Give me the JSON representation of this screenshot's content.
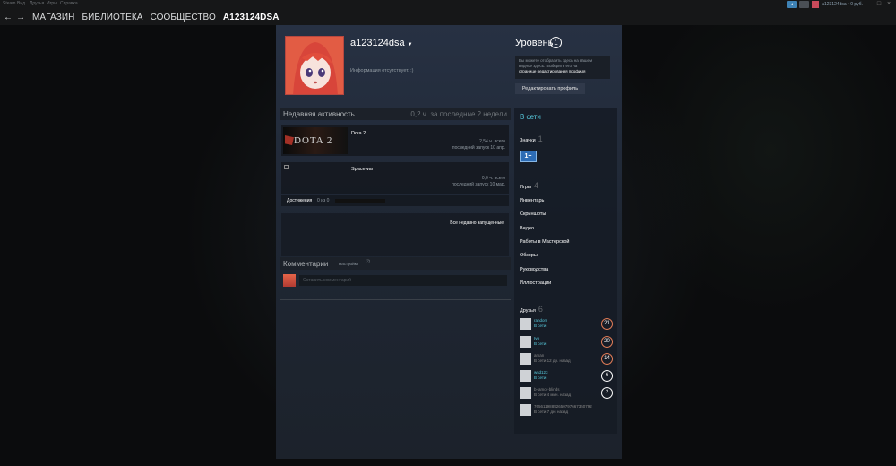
{
  "top_menu": {
    "items": [
      "Steam",
      "Вид",
      "Друзья",
      "Игры",
      "Справка"
    ],
    "user": "a123124dsa • 0 pуб.",
    "announce_icon": "megaphone-icon",
    "notification_icon": "bell-icon"
  },
  "nav": {
    "back": "←",
    "forward": "→",
    "links": [
      "МАГАЗИН",
      "БИБЛИОТЕКА",
      "СООБЩЕСТВО"
    ],
    "username": "A123124DSA"
  },
  "profile": {
    "persona_name": "a123124dsa",
    "no_summary": "Информация отсутствует. :)",
    "level_label": "Уровень",
    "level": "1",
    "level_info": [
      "Вы можете отобразить здесь на вашем",
      "видное здесь. Выберите его на",
      "странице редактирования профиля"
    ],
    "edit_button": "Редактировать профиль"
  },
  "activity": {
    "title": "Недавняя активность",
    "hours_summary": "0,2 ч. за последние 2 недели",
    "games": [
      {
        "name": "DOTA 2",
        "title": "Dota 2",
        "hours": "2,54 ч. всего",
        "last_played": "последний запуск 10 апр."
      },
      {
        "name": "Spacewar",
        "title": "Spacewar",
        "hours": "0,0 ч. всего",
        "last_played": "последний запуск 10 мар."
      }
    ],
    "achievements_label": "Достижения",
    "achievements_count": "0 из 0",
    "achievements_progress": 0,
    "all_games_link": "Все недавно запущенные"
  },
  "comments": {
    "title": "Комментарии",
    "privacy": "Настройки",
    "help": "(?)",
    "placeholder": "Оставить комментарий"
  },
  "sidebar": {
    "status": "В сети",
    "badges_label": "Значки",
    "badges_count": "1",
    "badge_text": "1+",
    "games_label": "Игры",
    "games_count": "4",
    "links": [
      "Инвентарь",
      "Скриншоты",
      "Видео",
      "Работы в Мастерской",
      "Обзоры",
      "Руководства",
      "Иллюстрации"
    ],
    "friends_label": "Друзья",
    "friends_count": "6",
    "friends": [
      {
        "name": "random",
        "status": "В сети",
        "level": "21",
        "level_color": "#e77f58",
        "online": true
      },
      {
        "name": "Ivo",
        "status": "В сети",
        "level": "20",
        "level_color": "#e77f58",
        "online": true
      },
      {
        "name": "aman",
        "status": "В сети 12 дн. назад",
        "level": "14",
        "level_color": "#e77f58",
        "online": false
      },
      {
        "name": "wsd123",
        "status": "В сети",
        "level": "6",
        "level_color": "#ffffff",
        "online": true
      },
      {
        "name": "b-lamor-blinds",
        "status": "В сети 4 мин. назад",
        "level": "2",
        "level_color": "#ffffff",
        "online": false
      },
      {
        "name": "76561198852650797667350792",
        "status": "В сети 7 дн. назад",
        "level": "",
        "level_color": "#ffffff",
        "online": false
      }
    ]
  }
}
